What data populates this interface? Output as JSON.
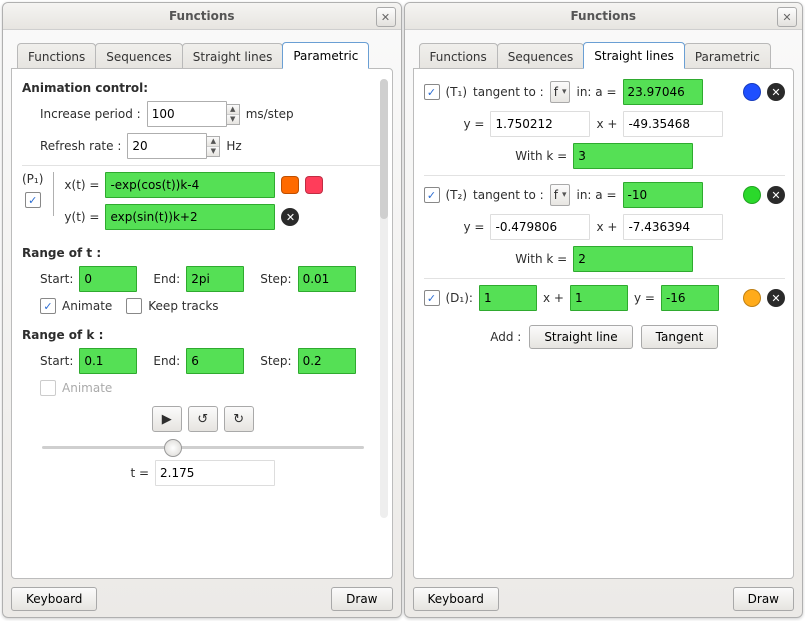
{
  "left": {
    "title": "Functions",
    "tabs": [
      "Functions",
      "Sequences",
      "Straight lines",
      "Parametric"
    ],
    "activeTab": 3,
    "anim": {
      "heading": "Animation control:",
      "increaseLabel": "Increase period :",
      "increaseValue": "100",
      "increaseUnit": "ms/step",
      "refreshLabel": "Refresh rate :",
      "refreshValue": "20",
      "refreshUnit": "Hz"
    },
    "param": {
      "name": "(P₁)",
      "xLabel": "x(t) =",
      "xValue": "-exp(cos(t))k-4",
      "yLabel": "y(t) =",
      "yValue": "exp(sin(t))k+2",
      "color1": "#ff6a00",
      "color2": "#ff3d5a"
    },
    "rangeT": {
      "heading": "Range of t :",
      "startLabel": "Start:",
      "startValue": "0",
      "endLabel": "End:",
      "endValue": "2pi",
      "stepLabel": "Step:",
      "stepValue": "0.01",
      "animateLabel": "Animate",
      "keepLabel": "Keep tracks"
    },
    "rangeK": {
      "heading": "Range of k :",
      "startLabel": "Start:",
      "startValue": "0.1",
      "endLabel": "End:",
      "endValue": "6",
      "stepLabel": "Step:",
      "stepValue": "0.2",
      "animateLabel": "Animate"
    },
    "tReadout": {
      "label": "t =",
      "value": "2.175"
    },
    "keyboard": "Keyboard",
    "draw": "Draw"
  },
  "right": {
    "title": "Functions",
    "tabs": [
      "Functions",
      "Sequences",
      "Straight lines",
      "Parametric"
    ],
    "activeTab": 2,
    "tangents": [
      {
        "name": "(T₁)",
        "tangentLabel": "tangent to :",
        "func": "f",
        "inLabel": "in: a =",
        "a": "23.97046",
        "yEq": "y  =",
        "slope": "1.750212",
        "xPlus": "x +",
        "intercept": "-49.35468",
        "withLabel": "With k =",
        "k": "3",
        "color": "#1e4fff"
      },
      {
        "name": "(T₂)",
        "tangentLabel": "tangent to :",
        "func": "f",
        "inLabel": "in: a =",
        "a": "-10",
        "yEq": "y  =",
        "slope": "-0.479806",
        "xPlus": "x +",
        "intercept": "-7.436394",
        "withLabel": "With k =",
        "k": "2",
        "color": "#2bd92b"
      }
    ],
    "line": {
      "name": "(D₁):",
      "a": "1",
      "xPlus": "x +",
      "b": "1",
      "yEq": "y =",
      "c": "-16",
      "color": "#ffab1a"
    },
    "addLabel": "Add :",
    "addStraight": "Straight line",
    "addTangent": "Tangent",
    "keyboard": "Keyboard",
    "draw": "Draw"
  }
}
